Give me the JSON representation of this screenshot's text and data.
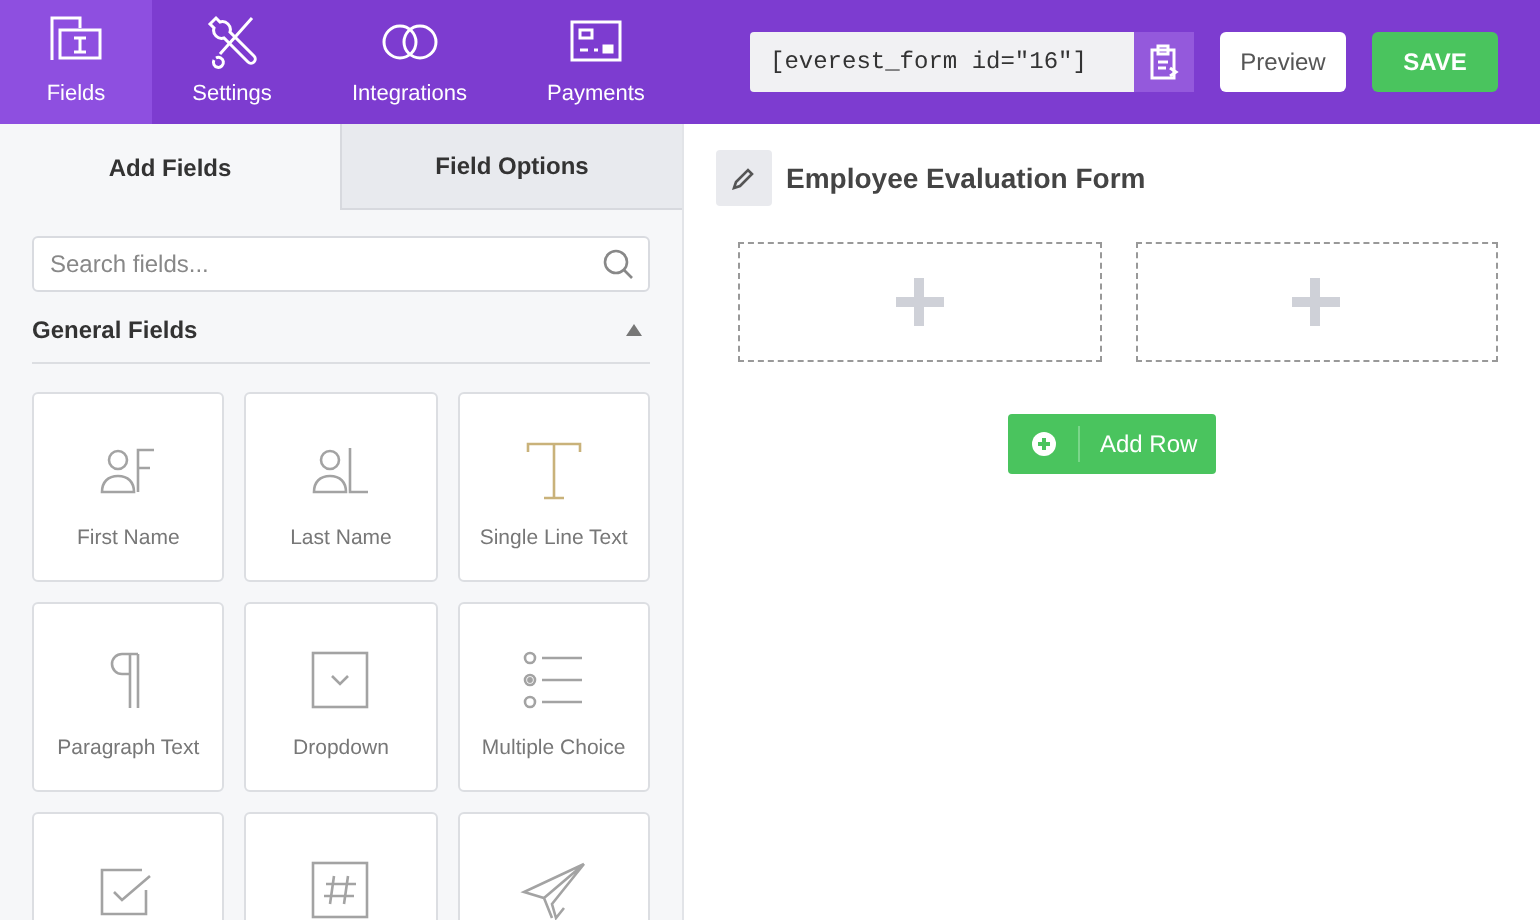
{
  "top_nav": [
    {
      "label": "Fields",
      "kind": "fields",
      "selected": true
    },
    {
      "label": "Settings",
      "kind": "settings",
      "selected": false
    },
    {
      "label": "Integrations",
      "kind": "integrations",
      "selected": false
    },
    {
      "label": "Payments",
      "kind": "payments",
      "selected": false
    }
  ],
  "shortcode": "[everest_form id=\"16\"]",
  "buttons": {
    "preview": "Preview",
    "save": "SAVE"
  },
  "panel_tabs": [
    {
      "label": "Add Fields",
      "selected": true
    },
    {
      "label": "Field Options",
      "selected": false
    }
  ],
  "search": {
    "placeholder": "Search fields..."
  },
  "section": {
    "title": "General Fields",
    "expanded": true
  },
  "fields": [
    {
      "label": "First Name",
      "kind": "first-name"
    },
    {
      "label": "Last Name",
      "kind": "last-name"
    },
    {
      "label": "Single Line Text",
      "kind": "text"
    },
    {
      "label": "Paragraph Text",
      "kind": "paragraph"
    },
    {
      "label": "Dropdown",
      "kind": "dropdown"
    },
    {
      "label": "Multiple Choice",
      "kind": "radio"
    },
    {
      "kind": "checkbox"
    },
    {
      "kind": "number"
    },
    {
      "kind": "email"
    }
  ],
  "form": {
    "title": "Employee Evaluation Form",
    "rows": [
      {
        "columns": [
          {
            "empty": true
          },
          {
            "empty": true
          }
        ]
      }
    ],
    "add_row": "Add Row"
  }
}
